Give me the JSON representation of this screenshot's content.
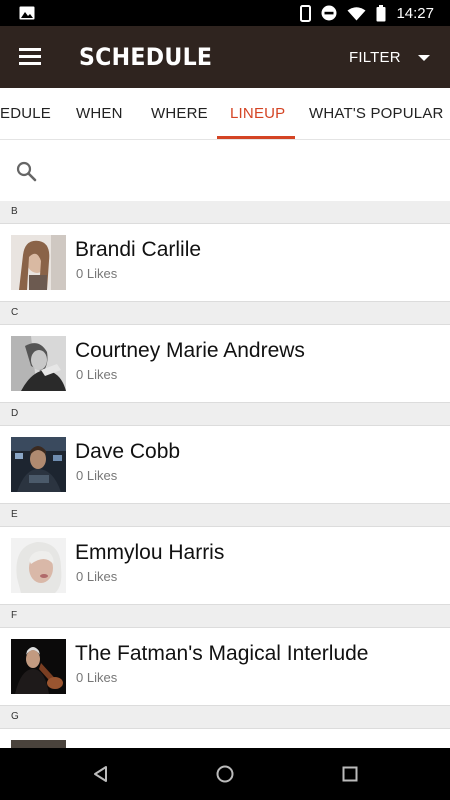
{
  "status_bar": {
    "time": "14:27",
    "icons": [
      "image-icon",
      "phone-icon",
      "do-not-disturb-icon",
      "wifi-icon",
      "battery-icon"
    ]
  },
  "app_bar": {
    "title": "SCHEDULE",
    "filter_label": "FILTER",
    "color": "#2f241f"
  },
  "tabs": [
    {
      "label": "EDULE",
      "active": false
    },
    {
      "label": "WHEN",
      "active": false
    },
    {
      "label": "WHERE",
      "active": false
    },
    {
      "label": "LINEUP",
      "active": true
    },
    {
      "label": "WHAT'S POPULAR",
      "active": false
    }
  ],
  "accent_color": "#d44424",
  "search": {
    "placeholder": ""
  },
  "sections": [
    {
      "letter": "B",
      "artists": [
        {
          "name": "Brandi Carlile",
          "likes": "0 Likes"
        }
      ]
    },
    {
      "letter": "C",
      "artists": [
        {
          "name": "Courtney Marie Andrews",
          "likes": "0 Likes"
        }
      ]
    },
    {
      "letter": "D",
      "artists": [
        {
          "name": "Dave Cobb",
          "likes": "0 Likes"
        }
      ]
    },
    {
      "letter": "E",
      "artists": [
        {
          "name": "Emmylou Harris",
          "likes": "0 Likes"
        }
      ]
    },
    {
      "letter": "F",
      "artists": [
        {
          "name": "The Fatman's Magical Interlude",
          "likes": "0 Likes"
        }
      ]
    },
    {
      "letter": "G",
      "artists": [
        {
          "name": "",
          "likes": ""
        }
      ]
    }
  ],
  "nav_bar": {
    "buttons": [
      "back-icon",
      "home-icon",
      "recents-icon"
    ]
  }
}
